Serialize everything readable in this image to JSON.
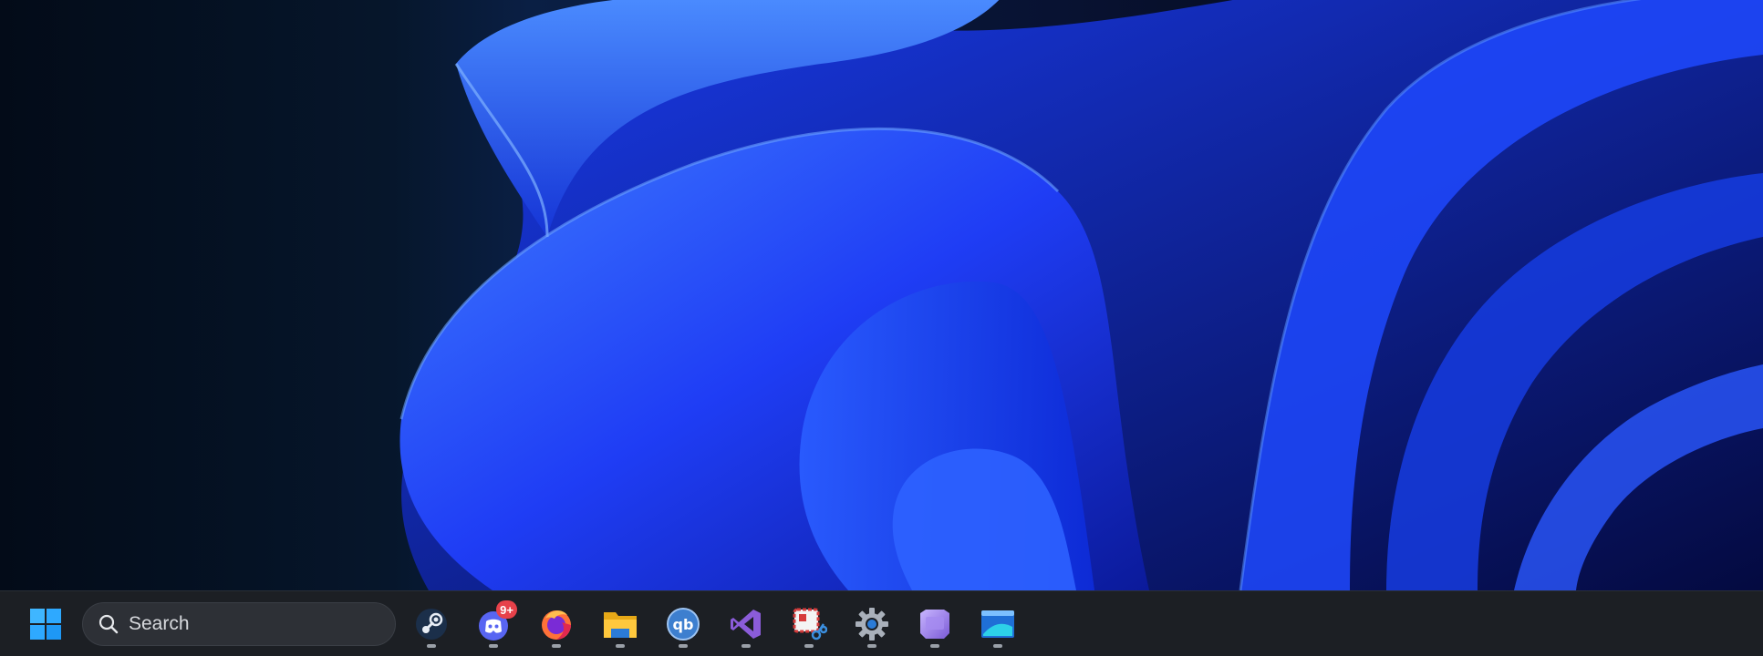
{
  "desktop": {
    "wallpaper": "windows-bloom-wallpaper",
    "accent": "#2f5bff"
  },
  "taskbar": {
    "start_icon": "windows-logo-icon",
    "search": {
      "placeholder": "Search",
      "icon": "search-icon"
    },
    "apps": [
      {
        "name": "steam",
        "icon": "steam-icon",
        "running": true
      },
      {
        "name": "discord",
        "icon": "discord-icon",
        "running": true,
        "badge": "9+"
      },
      {
        "name": "firefox",
        "icon": "firefox-icon",
        "running": true
      },
      {
        "name": "file-explorer",
        "icon": "folder-icon",
        "running": true
      },
      {
        "name": "qbittorrent",
        "icon": "qbittorrent-icon",
        "running": true
      },
      {
        "name": "visual-studio",
        "icon": "visual-studio-icon",
        "running": true
      },
      {
        "name": "snipping-tool",
        "icon": "snipping-tool-icon",
        "running": true
      },
      {
        "name": "settings",
        "icon": "gear-icon",
        "running": true
      },
      {
        "name": "graphics-app",
        "icon": "purple-app-icon",
        "running": true
      },
      {
        "name": "window-app",
        "icon": "blue-window-icon",
        "running": true
      }
    ]
  }
}
